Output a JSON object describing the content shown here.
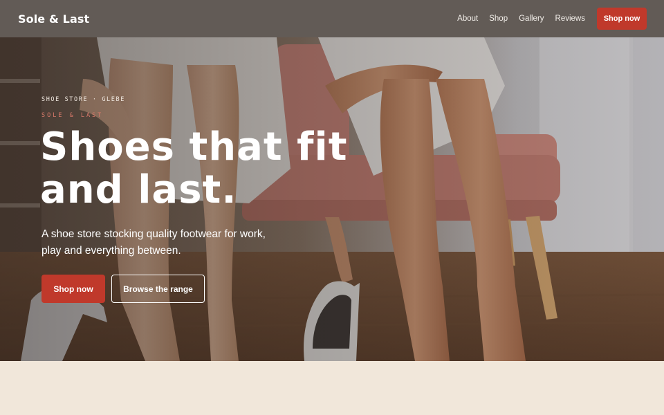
{
  "header": {
    "logo": "Sole & Last",
    "nav": [
      {
        "label": "About"
      },
      {
        "label": "Shop"
      },
      {
        "label": "Gallery"
      },
      {
        "label": "Reviews"
      }
    ],
    "cta_label": "Shop now"
  },
  "hero": {
    "eyebrow": "SHOE STORE · GLEBE",
    "brand_tag": "SOLE & LAST",
    "headline_line1": "Shoes that fit",
    "headline_line2": "and last.",
    "subtitle": "A shoe store stocking quality footwear for work, play and everything between.",
    "primary_button": "Shop now",
    "secondary_button": "Browse the range"
  },
  "colors": {
    "header_bg": "#625b56",
    "accent": "#c0392b",
    "brand_tag": "#d9796a",
    "page_bg": "#f1e7da"
  }
}
